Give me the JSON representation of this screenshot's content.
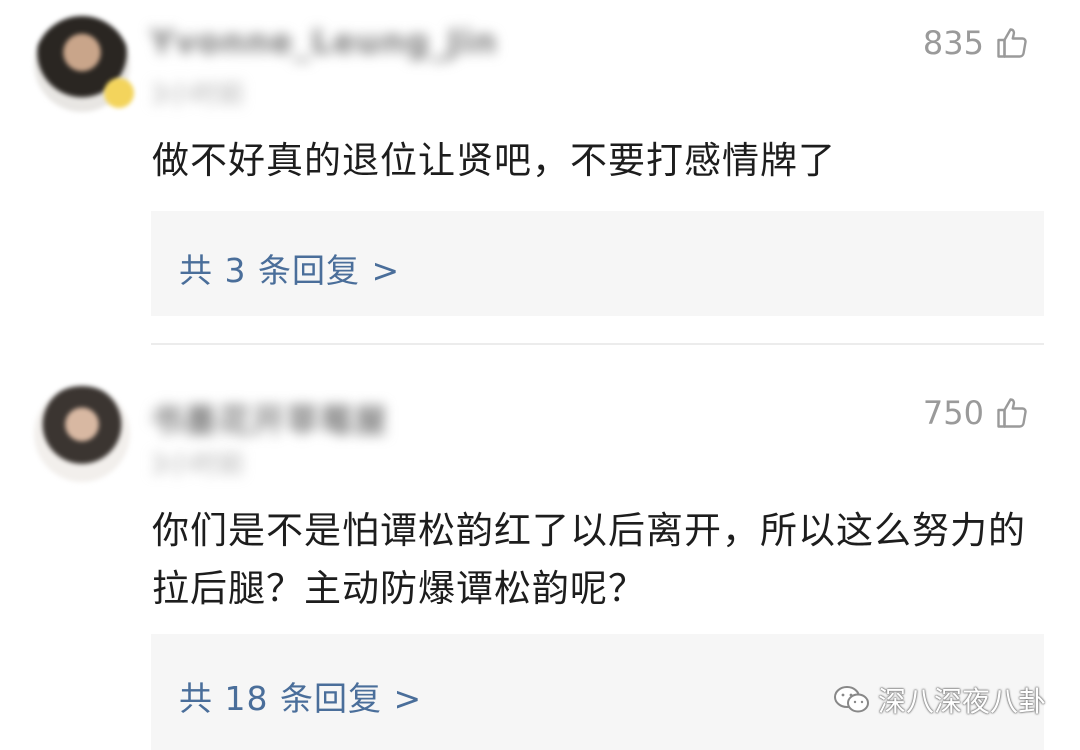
{
  "comments": [
    {
      "user_name": "Yvonne_Leung_Jin",
      "timestamp": "3小时前",
      "likes": "835",
      "text": "做不好真的退位让贤吧，不要打感情牌了",
      "reply_link": "共 3 条回复 >"
    },
    {
      "user_name": "书墨花开草莓屋",
      "timestamp": "3小时前",
      "likes": "750",
      "text": "你们是不是怕谭松韵红了以后离开，所以这么努力的拉后腿？主动防爆谭松韵呢？",
      "reply_link": "共 18 条回复 >"
    }
  ],
  "watermark": {
    "icon": "wechat-icon",
    "text": "深八深夜八卦"
  },
  "colors": {
    "reply_link": "#4a6e9a",
    "reply_bg": "#f6f6f6",
    "like_gray": "#9a9a9a"
  }
}
